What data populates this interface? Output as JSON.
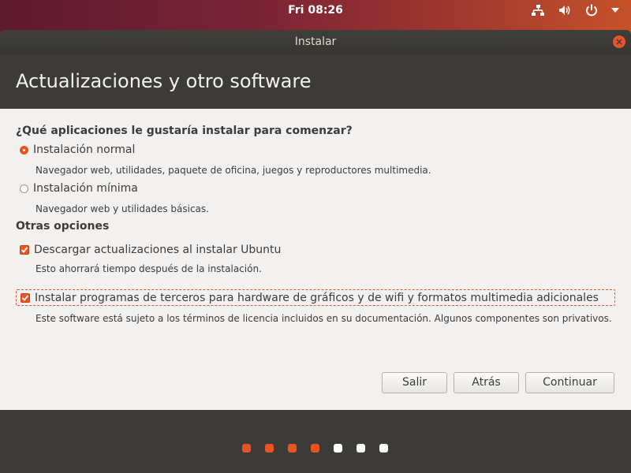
{
  "top_panel": {
    "clock": "Fri 08:26",
    "icons": [
      "network-icon",
      "volume-icon",
      "power-icon",
      "menu-arrow-icon"
    ]
  },
  "window": {
    "title": "Instalar",
    "close_icon": "close-icon"
  },
  "header": {
    "title": "Actualizaciones y otro software"
  },
  "content": {
    "question": "¿Qué aplicaciones le gustaría instalar para comenzar?",
    "install_options": [
      {
        "label": "Instalación normal",
        "description": "Navegador web, utilidades, paquete de oficina, juegos y reproductores multimedia.",
        "selected": true
      },
      {
        "label": "Instalación mínima",
        "description": "Navegador web y utilidades básicas.",
        "selected": false
      }
    ],
    "other_heading": "Otras opciones",
    "other_options": [
      {
        "label": "Descargar actualizaciones al instalar Ubuntu",
        "description": "Esto ahorrará tiempo después de la instalación.",
        "checked": true
      },
      {
        "label": "Instalar programas de terceros para hardware de gráficos y de wifi y formatos multimedia adicionales",
        "description": "Este software está sujeto a los términos de licencia incluidos en su documentación. Algunos componentes son privativos.",
        "checked": true
      }
    ]
  },
  "buttons": {
    "quit": "Salir",
    "back": "Atrás",
    "continue": "Continuar"
  },
  "progress": {
    "total_steps": 7,
    "completed_steps": 4,
    "active_color": "#e95420",
    "inactive_color": "#ffffff"
  },
  "colors": {
    "accent": "#e95420",
    "window_bg": "#3c3b37",
    "content_bg": "#f2f1f0"
  }
}
